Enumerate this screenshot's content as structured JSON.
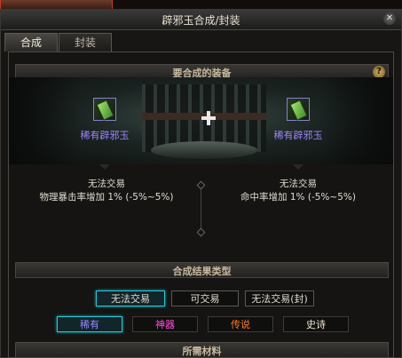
{
  "scene_label": "",
  "window": {
    "title": "辟邪玉合成/封装",
    "close_icon": "close-icon"
  },
  "tabs": [
    {
      "label": "合成",
      "active": true
    },
    {
      "label": "封装",
      "active": false
    }
  ],
  "equip_section": {
    "title": "要合成的装备",
    "help": "?",
    "left_item": {
      "name": "稀有辟邪玉",
      "trade": "无法交易",
      "stat": "物理暴击率增加 1% (-5%~5%)"
    },
    "right_item": {
      "name": "稀有辟邪玉",
      "trade": "无法交易",
      "stat": "命中率增加 1% (-5%~5%)"
    }
  },
  "result_section": {
    "title": "合成结果类型",
    "trade_options": [
      {
        "label": "无法交易",
        "selected": true
      },
      {
        "label": "可交易",
        "selected": false
      },
      {
        "label": "无法交易(封)",
        "selected": false
      }
    ],
    "rarity_options": [
      {
        "label": "稀有",
        "color": "#9c86ff",
        "selected": true
      },
      {
        "label": "神器",
        "color": "#ff4fd8",
        "selected": false
      },
      {
        "label": "传说",
        "color": "#ff7a2a",
        "selected": false
      },
      {
        "label": "史诗",
        "color": "#f0e6cf",
        "selected": false
      }
    ]
  },
  "materials_section": {
    "title": "所需材料"
  }
}
